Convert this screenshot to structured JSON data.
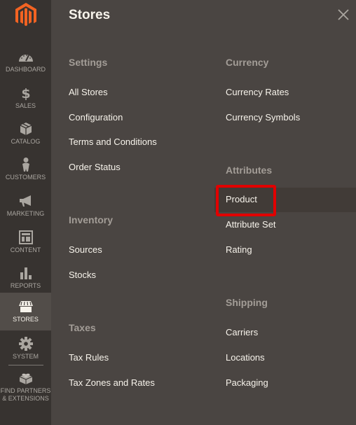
{
  "sidebar": {
    "logo": "magento-logo",
    "items": [
      {
        "label": "Dashboard",
        "icon": "dashboard-gauge-icon",
        "active": false
      },
      {
        "label": "Sales",
        "icon": "dollar-icon",
        "active": false
      },
      {
        "label": "Catalog",
        "icon": "box-icon",
        "active": false
      },
      {
        "label": "Customers",
        "icon": "person-icon",
        "active": false
      },
      {
        "label": "Marketing",
        "icon": "megaphone-icon",
        "active": false
      },
      {
        "label": "Content",
        "icon": "layout-icon",
        "active": false
      },
      {
        "label": "Reports",
        "icon": "bar-chart-icon",
        "active": false
      },
      {
        "label": "Stores",
        "icon": "storefront-icon",
        "active": true
      },
      {
        "label": "System",
        "icon": "gear-icon",
        "active": false
      },
      {
        "label": "Find Partners & Extensions",
        "label_line1": "Find Partners",
        "label_line2": "& Extensions",
        "icon": "lego-brick-icon",
        "active": false
      }
    ]
  },
  "panel": {
    "title": "Stores",
    "close_icon": "close-icon",
    "groups": {
      "settings": {
        "title": "Settings",
        "items": [
          "All Stores",
          "Configuration",
          "Terms and Conditions",
          "Order Status"
        ]
      },
      "inventory": {
        "title": "Inventory",
        "items": [
          "Sources",
          "Stocks"
        ]
      },
      "taxes": {
        "title": "Taxes",
        "items": [
          "Tax Rules",
          "Tax Zones and Rates"
        ]
      },
      "currency": {
        "title": "Currency",
        "items": [
          "Currency Rates",
          "Currency Symbols"
        ]
      },
      "attributes": {
        "title": "Attributes",
        "items": [
          "Product",
          "Attribute Set",
          "Rating"
        ]
      },
      "shipping": {
        "title": "Shipping",
        "items": [
          "Carriers",
          "Locations",
          "Packaging"
        ]
      }
    },
    "highlighted_item": "Product",
    "highlight_color": "#e10000"
  }
}
